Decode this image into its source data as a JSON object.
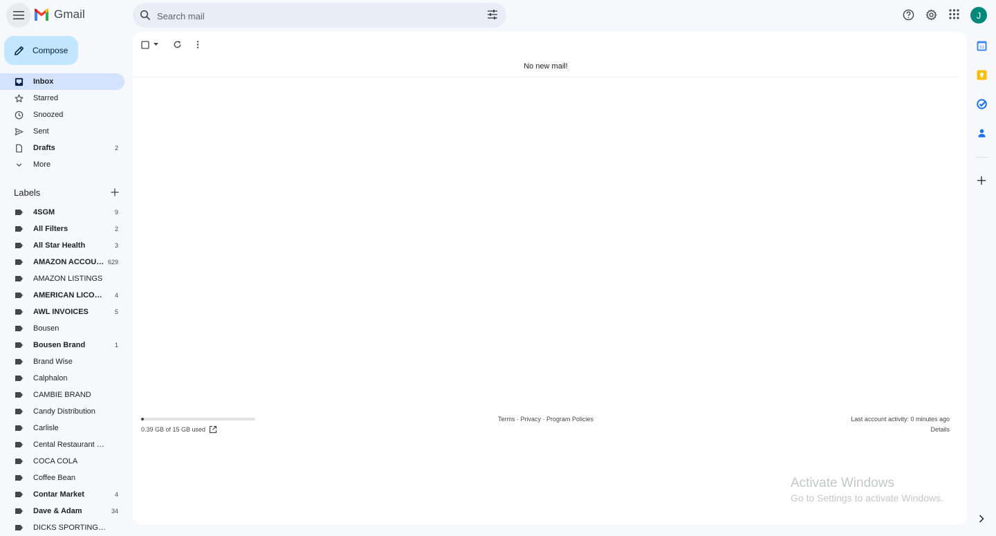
{
  "app": {
    "name": "Gmail"
  },
  "search": {
    "placeholder": "Search mail"
  },
  "account": {
    "avatar_initial": "J"
  },
  "compose": {
    "label": "Compose"
  },
  "nav": {
    "items": [
      {
        "label": "Inbox",
        "count": ""
      },
      {
        "label": "Starred",
        "count": ""
      },
      {
        "label": "Snoozed",
        "count": ""
      },
      {
        "label": "Sent",
        "count": ""
      },
      {
        "label": "Drafts",
        "count": "2"
      },
      {
        "label": "More",
        "count": ""
      }
    ]
  },
  "labels": {
    "title": "Labels",
    "items": [
      {
        "label": "4SGM",
        "count": "9"
      },
      {
        "label": "All Filters",
        "count": "2"
      },
      {
        "label": "All Star Health",
        "count": "3"
      },
      {
        "label": "AMAZON ACCOUNT",
        "count": "629"
      },
      {
        "label": "AMAZON LISTINGS",
        "count": ""
      },
      {
        "label": "AMERICAN LICORICE",
        "count": "4"
      },
      {
        "label": "AWL INVOICES",
        "count": "5"
      },
      {
        "label": "Bousen",
        "count": ""
      },
      {
        "label": "Bousen Brand",
        "count": "1"
      },
      {
        "label": "Brand Wise",
        "count": ""
      },
      {
        "label": "Calphalon",
        "count": ""
      },
      {
        "label": "CAMBIE BRAND",
        "count": ""
      },
      {
        "label": "Candy Distribution",
        "count": ""
      },
      {
        "label": "Carlisle",
        "count": ""
      },
      {
        "label": "Cental Restaurant Quotes",
        "count": ""
      },
      {
        "label": "COCA COLA",
        "count": ""
      },
      {
        "label": "Coffee Bean",
        "count": ""
      },
      {
        "label": "Contar Market",
        "count": "4"
      },
      {
        "label": "Dave & Adam",
        "count": "34"
      },
      {
        "label": "DICKS SPORTING GOODS",
        "count": ""
      }
    ]
  },
  "main": {
    "empty_message": "No new mail!",
    "storage_used": "0.39 GB of 15 GB used",
    "storage_fraction": 0.026,
    "footer_links": "Terms · Privacy · Program Policies",
    "last_activity": "Last account activity: 0 minutes ago",
    "details_link": "Details"
  },
  "watermark": {
    "line1": "Activate Windows",
    "line2": "Go to Settings to activate Windows."
  },
  "colors": {
    "accent": "#0b57d0",
    "compose_bg": "#c2e7ff",
    "active_nav": "#d3e3fd",
    "avatar": "#00897b"
  }
}
